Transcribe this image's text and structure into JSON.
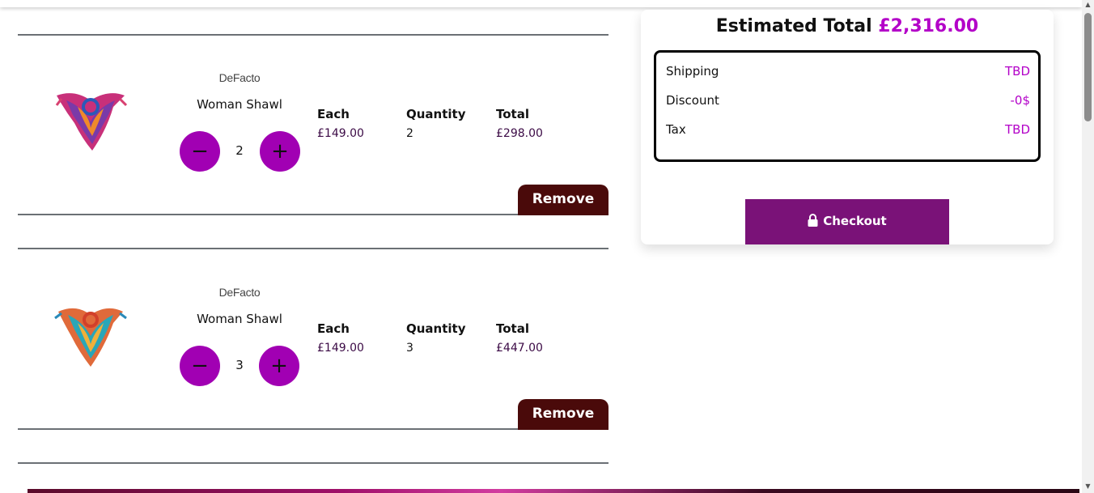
{
  "cart": {
    "items": [
      {
        "brand": "DeFacto",
        "name": "Woman Shawl",
        "quantity": "2",
        "each_label": "Each",
        "each_value": "£149.00",
        "quantity_label": "Quantity",
        "quantity_value": "2",
        "total_label": "Total",
        "total_value": "£298.00",
        "remove_label": "Remove",
        "minus_symbol": "−",
        "plus_symbol": "+"
      },
      {
        "brand": "DeFacto",
        "name": "Woman Shawl",
        "quantity": "3",
        "each_label": "Each",
        "each_value": "£149.00",
        "quantity_label": "Quantity",
        "quantity_value": "3",
        "total_label": "Total",
        "total_value": "£447.00",
        "remove_label": "Remove",
        "minus_symbol": "−",
        "plus_symbol": "+"
      }
    ]
  },
  "summary": {
    "title": "Estimated Total",
    "total_amount": "£2,316.00",
    "rows": [
      {
        "label": "Shipping",
        "value": "TBD"
      },
      {
        "label": "Discount",
        "value": "-0$"
      },
      {
        "label": "Tax",
        "value": "TBD"
      }
    ],
    "checkout_label": "Checkout"
  },
  "colors": {
    "accent": "#a100b3",
    "price_highlight": "#b300c8",
    "remove_button": "#4a0a0a",
    "checkout_button": "#7a1278"
  },
  "icons": [
    "minus-icon",
    "plus-icon",
    "lock-icon",
    "shawl-product-image"
  ]
}
